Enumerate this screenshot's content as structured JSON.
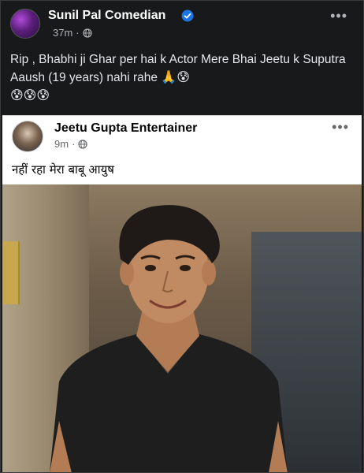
{
  "outer_post": {
    "author": "Sunil Pal Comedian",
    "time": "37m",
    "text": "Rip , Bhabhi ji Ghar per hai k Actor Mere Bhai Jeetu k Suputra Aaush (19 years) nahi rahe",
    "emojis": "🙏😰",
    "emojis_line2": "😰😰😰"
  },
  "shared_post": {
    "author": "Jeetu Gupta Entertainer",
    "time": "9m",
    "text": "नहीं रहा मेरा बाबू आयुष"
  },
  "icons": {
    "more": "•••",
    "dot": "·"
  },
  "colors": {
    "dark_bg": "#18191a",
    "verified_blue": "#1b74e4",
    "shirt": "#1e1e1e"
  }
}
